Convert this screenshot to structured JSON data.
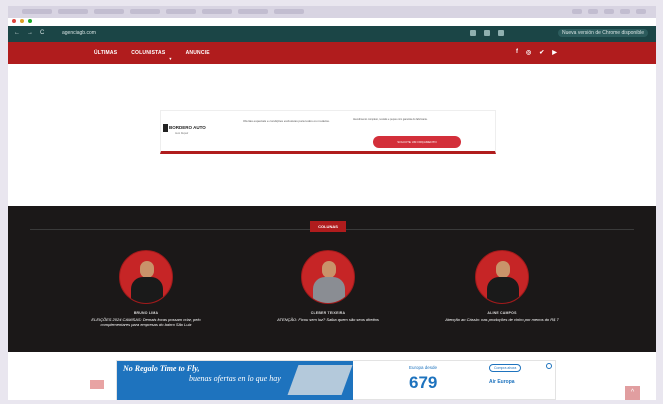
{
  "browser": {
    "url": "agenciagb.com",
    "update_notice": "Nueva versión de Chrome disponible",
    "nav_back": "←",
    "nav_forward": "→",
    "nav_reload": "C"
  },
  "site": {
    "menu": [
      "ÚLTIMAS",
      "COLUNISTAS",
      "ANUNCIE"
    ],
    "social_icons": [
      "facebook-icon",
      "instagram-icon",
      "twitter-icon",
      "youtube-icon"
    ],
    "social_glyphs": [
      "f",
      "◎",
      "✔",
      "▶"
    ]
  },
  "top_ad": {
    "brand": "BORDERO AUTO",
    "subtext": "Auto Repair",
    "middle_text": "Ofertas especiais e condições exclusivas para todos os modelos.",
    "bullets": "Atendimento completo, revisão e peças com garantia do fabricante.",
    "cta": "SOLICITE UM ORÇAMENTO"
  },
  "colunas": {
    "tag": "COLUNAS",
    "items": [
      {
        "name": "BRUNO LIMA",
        "title": "ELEIÇÕES 2024 CAMISAS: Demais focas possam criar, pelo complementares para empresas do bairro São Luiz"
      },
      {
        "name": "CLEBER TEIXEIRA",
        "title": "ATENÇÃO: Ficou sem luz? Saiba quem são seus direitos"
      },
      {
        "name": "ALINE CAMPOS",
        "title": "Atenção ao Cássio: nas produções de vinho por menos do R$ 7"
      }
    ]
  },
  "bottom_ad": {
    "line1": "No Regalo Time to Fly,",
    "line2": "buenas ofertas en lo que hay",
    "price_label": "Europa desde",
    "price": "679",
    "cta": "Compra ahora",
    "brand": "Air Europa"
  },
  "back_to_top": "^"
}
